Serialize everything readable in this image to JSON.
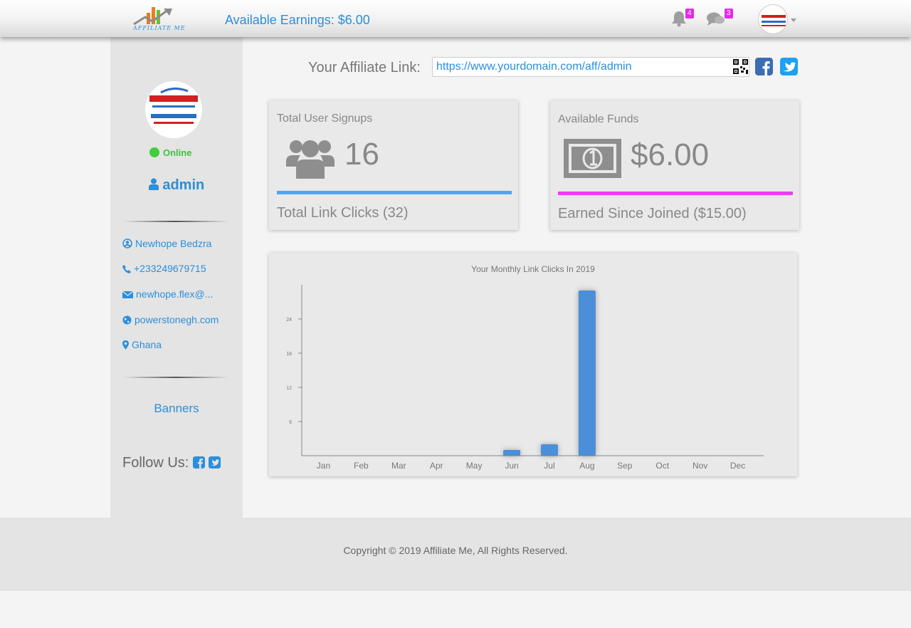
{
  "header": {
    "logo_text": "AFFILIATE ME",
    "earnings": "Available Earnings: $6.00",
    "notifications_count": "4",
    "messages_count": "3"
  },
  "sidebar": {
    "status": "Online",
    "username": "admin",
    "info": {
      "name": "Newhope Bedzra",
      "phone": "+233249679715",
      "email": "newhope.flex@...",
      "website": "powerstonegh.com",
      "location": "Ghana"
    },
    "banners": "Banners",
    "follow": "Follow Us:"
  },
  "affiliate": {
    "label": "Your Affiliate Link:",
    "url": "https://www.yourdomain.com/aff/admin"
  },
  "cards": {
    "signups": {
      "title": "Total User Signups",
      "value": "16",
      "footer": "Total Link Clicks (32)",
      "accent": "#4da6f2"
    },
    "funds": {
      "title": "Available Funds",
      "value": "$6.00",
      "footer": "Earned Since Joined ($15.00)",
      "accent": "#f03cf0"
    }
  },
  "chart_data": {
    "type": "bar",
    "title": "Your Monthly Link Clicks In 2019",
    "categories": [
      "Jan",
      "Feb",
      "Mar",
      "Apr",
      "May",
      "Jun",
      "Jul",
      "Aug",
      "Sep",
      "Oct",
      "Nov",
      "Dec"
    ],
    "values": [
      0,
      0,
      0,
      0,
      0,
      1,
      2,
      29,
      0,
      0,
      0,
      0
    ],
    "yticks": [
      6,
      12,
      18,
      24
    ],
    "ylim": [
      0,
      30
    ],
    "xlabel": "",
    "ylabel": "",
    "bar_color": "#4a8fd8",
    "grid": false,
    "legend": false
  },
  "footer": {
    "copyright": "Copyright © 2019 Affiliate Me, All Rights Reserved."
  },
  "colors": {
    "brand": "#2a8fdc",
    "online": "#3ecf3e",
    "badge": "#e62ae6"
  }
}
